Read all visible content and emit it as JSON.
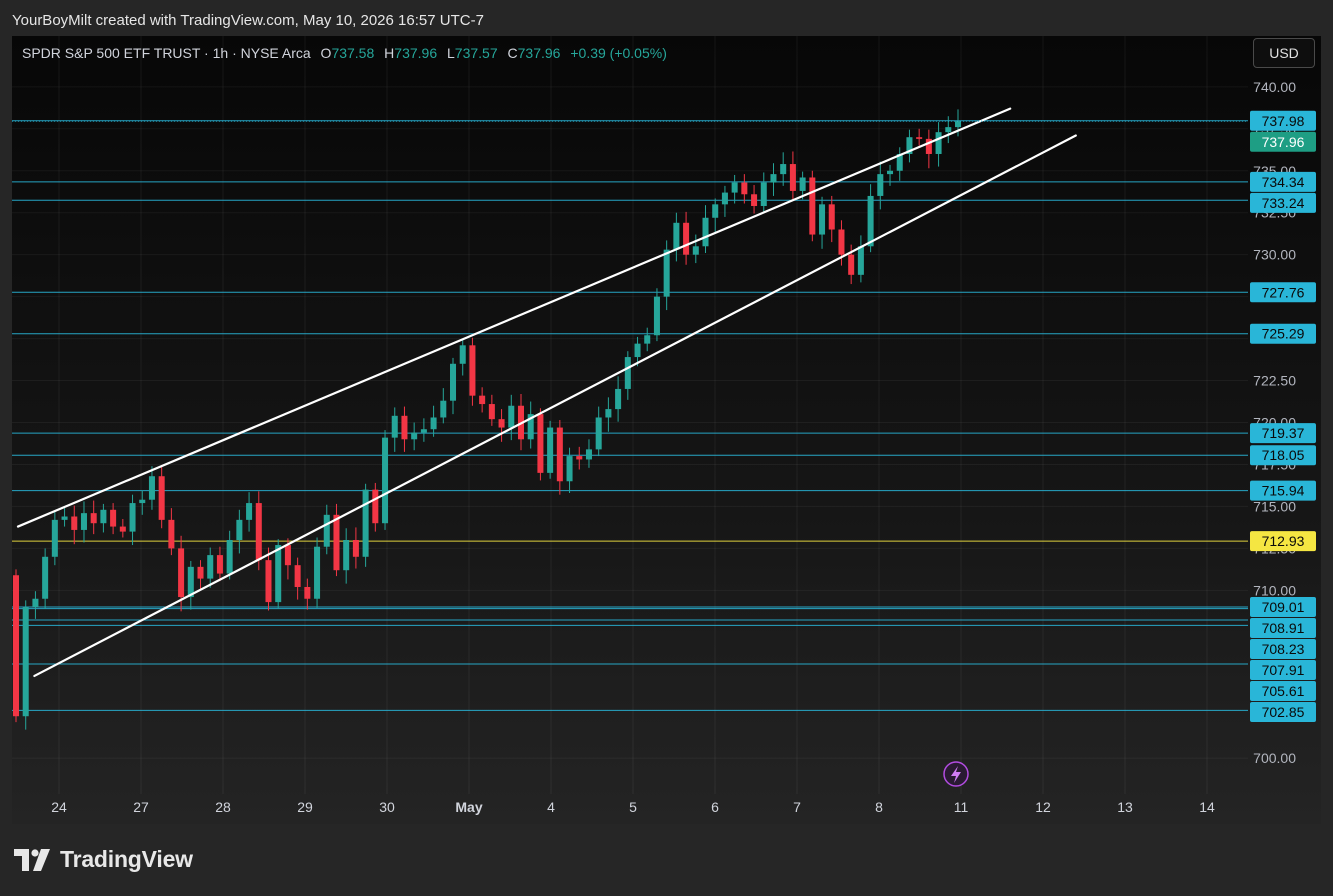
{
  "header": {
    "attribution": "YourBoyMilt created with TradingView.com, May 10, 2026 16:57 UTC-7"
  },
  "legend": {
    "symbol": "SPDR S&P 500 ETF TRUST · 1h · NYSE Arca",
    "open_label": "O",
    "open": "737.58",
    "high_label": "H",
    "high": "737.96",
    "low_label": "L",
    "low": "737.57",
    "close_label": "C",
    "close": "737.96",
    "change": "+0.39 (+0.05%)"
  },
  "currency_button": "USD",
  "footer": {
    "brand": "TradingView"
  },
  "colors": {
    "up": "#26a69a",
    "down": "#f23645",
    "level": "#29b6d8",
    "highlight": "#f5e642",
    "trend": "#ffffff",
    "last": "#1e9e84"
  },
  "chart_data": {
    "type": "candlestick",
    "title": "SPDR S&P 500 ETF TRUST · 1h · NYSE Arca",
    "y_axis": {
      "min": 698.7,
      "max": 741.6,
      "ticks": [
        "740.00",
        "737.50",
        "735.00",
        "732.50",
        "730.00",
        "727.50",
        "725.00",
        "722.50",
        "720.00",
        "717.50",
        "715.00",
        "712.50",
        "710.00",
        "700.00"
      ]
    },
    "x_axis": {
      "ticks": [
        "24",
        "27",
        "28",
        "29",
        "30",
        "May",
        "4",
        "5",
        "6",
        "7",
        "8",
        "11",
        "12",
        "13",
        "14"
      ]
    },
    "ohlc_path": [
      710.9,
      702.5,
      709.0,
      709.5,
      712.0,
      714.2,
      714.4,
      713.6,
      714.6,
      714.0,
      714.8,
      713.8,
      713.5,
      715.2,
      715.4,
      716.8,
      714.2,
      712.5,
      709.6,
      711.4,
      710.7,
      712.1,
      711.0,
      713.0,
      714.2,
      715.2,
      711.8,
      709.3,
      712.7,
      711.5,
      710.2,
      709.5,
      712.6,
      714.5,
      711.2,
      713.0,
      712.0,
      716.0,
      714.0,
      719.1,
      720.4,
      719.0,
      719.4,
      719.6,
      720.3,
      721.3,
      723.5,
      724.6,
      721.6,
      721.1,
      720.2,
      719.7,
      721.0,
      719.0,
      720.5,
      717.0,
      719.7,
      716.5,
      718.0,
      717.8,
      718.4,
      720.3,
      720.8,
      722.0,
      723.9,
      724.7,
      725.2,
      727.5,
      730.3,
      731.9,
      730.0,
      730.5,
      732.2,
      733.0,
      733.7,
      734.3,
      733.6,
      732.9,
      734.3,
      734.8,
      735.4,
      733.8,
      734.6,
      731.2,
      733.0,
      731.5,
      730.0,
      728.8,
      730.5,
      733.5,
      734.8,
      735.0,
      736.0,
      737.0,
      736.9,
      736.0,
      737.3,
      737.6,
      737.96
    ],
    "current_price": "737.96",
    "levels": [
      {
        "value": "737.98",
        "kind": "level"
      },
      {
        "value": "734.34",
        "kind": "level"
      },
      {
        "value": "733.24",
        "kind": "level"
      },
      {
        "value": "727.76",
        "kind": "level"
      },
      {
        "value": "725.29",
        "kind": "level"
      },
      {
        "value": "719.37",
        "kind": "level"
      },
      {
        "value": "718.05",
        "kind": "level"
      },
      {
        "value": "715.94",
        "kind": "level"
      },
      {
        "value": "712.93",
        "kind": "highlight"
      },
      {
        "value": "709.01",
        "kind": "level"
      },
      {
        "value": "708.91",
        "kind": "level"
      },
      {
        "value": "708.23",
        "kind": "level"
      },
      {
        "value": "707.91",
        "kind": "level"
      },
      {
        "value": "705.61",
        "kind": "level"
      },
      {
        "value": "702.85",
        "kind": "level"
      }
    ],
    "trendlines": [
      {
        "from": {
          "x": "26.5",
          "y": 713.8
        },
        "to": {
          "x": "11.6",
          "y": 738.7
        }
      },
      {
        "from": {
          "x": "29.7",
          "y": 704.9
        },
        "to": {
          "x": "12.4",
          "y": 737.1
        }
      }
    ]
  }
}
